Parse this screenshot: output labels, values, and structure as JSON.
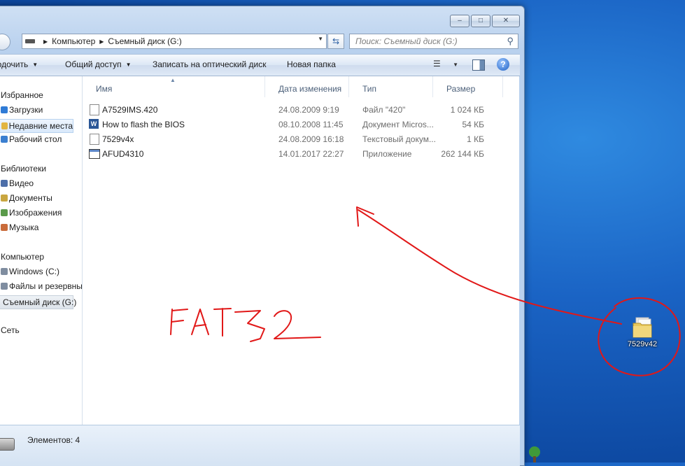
{
  "window": {
    "title_buttons": [
      "minimize",
      "maximize",
      "close"
    ]
  },
  "address": {
    "crumbs": [
      "Компьютер",
      "Съемный диск (G:)"
    ],
    "search_placeholder": "Поиск: Съемный диск (G:)"
  },
  "commands": {
    "organize": "родочить",
    "share": "Общий доступ",
    "burn": "Записать на оптический диск",
    "new_folder": "Новая папка"
  },
  "nav": {
    "favorites_head": "Избранное",
    "favorites": [
      "Загрузки",
      "Недавние места",
      "Рабочий стол"
    ],
    "libraries_head": "Библиотеки",
    "libraries": [
      "Видео",
      "Документы",
      "Изображения",
      "Музыка"
    ],
    "computer_head": "Компьютер",
    "computer": [
      "Windows (C:)",
      "Файлы и резервны",
      "Съемный диск (G:)"
    ],
    "network_head": "Сеть"
  },
  "columns": {
    "name": "Имя",
    "date": "Дата изменения",
    "type": "Тип",
    "size": "Размер"
  },
  "files": [
    {
      "name": "A7529IMS.420",
      "date": "24.08.2009 9:19",
      "type": "Файл \"420\"",
      "size": "1 024 КБ",
      "icon": "file-icon"
    },
    {
      "name": "How to flash the BIOS",
      "date": "08.10.2008 11:45",
      "type": "Документ Micros...",
      "size": "54 КБ",
      "icon": "word-doc-icon"
    },
    {
      "name": "7529v4x",
      "date": "24.08.2009 16:18",
      "type": "Текстовый докум...",
      "size": "1 КБ",
      "icon": "text-file-icon"
    },
    {
      "name": "AFUD4310",
      "date": "14.01.2017 22:27",
      "type": "Приложение",
      "size": "262 144 КБ",
      "icon": "application-icon"
    }
  ],
  "status": {
    "items": "Элементов: 4"
  },
  "desktop": {
    "folder_label": "7529v42"
  },
  "annotation": {
    "handwritten_text": "FAT32",
    "color": "#e11818"
  }
}
